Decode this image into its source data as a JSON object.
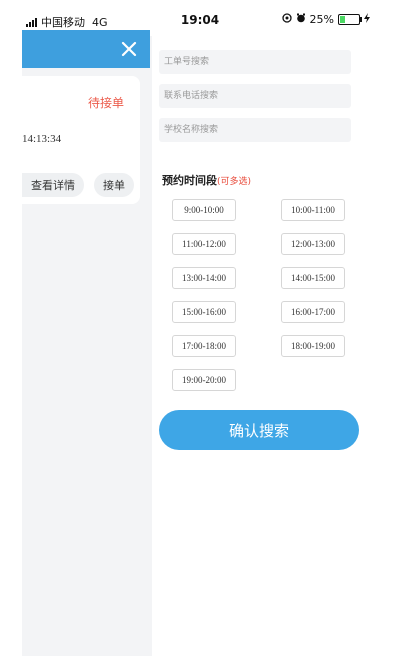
{
  "status_bar": {
    "carrier": "中国移动",
    "network": "4G",
    "time": "19:04",
    "battery_percent": "25%",
    "battery_level": 0.25
  },
  "left_panel": {
    "order_status": "待接单",
    "order_time": "14:13:34",
    "detail_button": "查看详情",
    "accept_button": "接单"
  },
  "search": {
    "order_no_placeholder": "工单号搜索",
    "phone_placeholder": "联系电话搜索",
    "school_placeholder": "学校名称搜索"
  },
  "time_section": {
    "title": "预约时间段",
    "hint": "(可多选)"
  },
  "time_slots": [
    "9:00-10:00",
    "10:00-11:00",
    "11:00-12:00",
    "12:00-13:00",
    "13:00-14:00",
    "14:00-15:00",
    "15:00-16:00",
    "16:00-17:00",
    "17:00-18:00",
    "18:00-19:00",
    "19:00-20:00"
  ],
  "confirm_button": "确认搜索",
  "colors": {
    "header_blue": "#3e9fde",
    "button_blue": "#3ea6e6",
    "status_red": "#ec5a4a"
  }
}
